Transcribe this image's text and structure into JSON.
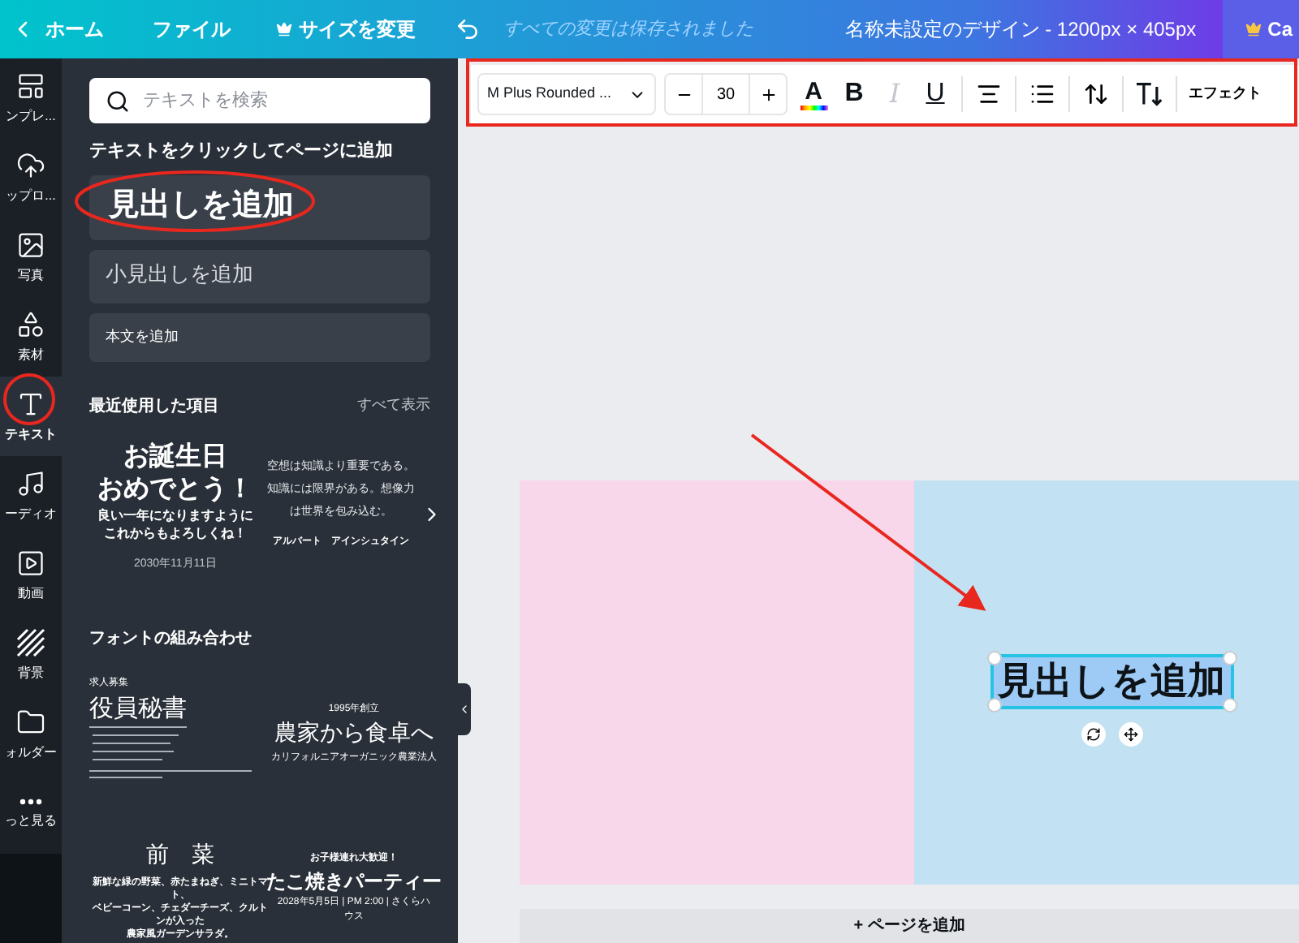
{
  "top_bar": {
    "back": "ホーム",
    "file": "ファイル",
    "resize": "サイズを変更",
    "save_status": "すべての変更は保存されました",
    "design_title": "名称未設定のデザイン - 1200px × 405px",
    "upgrade": "Ca"
  },
  "rail": [
    {
      "label": "ンプレ...",
      "kind": "layout",
      "selected": false
    },
    {
      "label": "ップロ...",
      "kind": "upload",
      "selected": false
    },
    {
      "label": "写真",
      "kind": "image",
      "selected": false
    },
    {
      "label": "素材",
      "kind": "shapes",
      "selected": false
    },
    {
      "label": "テキスト",
      "kind": "text",
      "selected": true
    },
    {
      "label": "ーディオ",
      "kind": "music",
      "selected": false
    },
    {
      "label": "動画",
      "kind": "video",
      "selected": false
    },
    {
      "label": "背景",
      "kind": "stripes",
      "selected": false
    },
    {
      "label": "ォルダー",
      "kind": "folder",
      "selected": false
    },
    {
      "label": "っと見る",
      "kind": "more",
      "selected": false
    }
  ],
  "panel": {
    "search": {
      "placeholder": "テキストを検索"
    },
    "add_heading": "テキストをクリックしてページに追加",
    "add_buttons": [
      {
        "kind": "heading",
        "label": "見出しを追加"
      },
      {
        "kind": "subheading",
        "label": "小見出しを追加"
      },
      {
        "kind": "body",
        "label": "本文を追加"
      }
    ],
    "recent": {
      "title": "最近使用した項目",
      "see_all": "すべて表示",
      "cards": [
        {
          "lines": [
            "お誕生日",
            "おめでとう！"
          ],
          "sub": [
            "良い一年になりますように",
            "これからもよろしくね！"
          ],
          "date": "2030年11月11日"
        },
        {
          "lines": [
            "空想は知識より重要である。",
            "知識には限界がある。想像力",
            "は世界を包み込む。"
          ],
          "author": "アルバート　アインシュタイン"
        }
      ]
    },
    "pairs": {
      "title": "フォントの組み合わせ",
      "cards": [
        {
          "kind": "job",
          "label": "求人募集",
          "title": "役員秘書"
        },
        {
          "kind": "farm",
          "year": "1995年創立",
          "title": "農家から食卓へ",
          "sub": "カリフォルニアオーガニック農業法人"
        },
        {
          "kind": "menu",
          "title": "前　菜",
          "lines": [
            "新鮮な緑の野菜、赤たまねぎ、ミニトマト、",
            "ベビーコーン、チェダーチーズ、クルトンが入った",
            "農家風ガーデンサラダ。"
          ]
        },
        {
          "kind": "party",
          "label": "お子様連れ大歓迎！",
          "title": "たこ焼きパーティー",
          "sub": "2028年5月5日 | PM 2:00 | さくらハウス"
        }
      ]
    }
  },
  "toolbar": {
    "font": "M Plus Rounded ...",
    "size": "30",
    "tools": [
      {
        "kind": "color",
        "label": "A"
      },
      {
        "kind": "bold",
        "label": "B",
        "disabled": false
      },
      {
        "kind": "italic",
        "label": "I",
        "disabled": true
      },
      {
        "kind": "underline",
        "label": "U",
        "disabled": false
      },
      {
        "kind": "align"
      },
      {
        "kind": "list"
      },
      {
        "kind": "spacing"
      },
      {
        "kind": "vertical"
      }
    ],
    "effects": "エフェクト"
  },
  "canvas": {
    "text": "見出しを追加",
    "selected": true,
    "add_page": "+ ページを追加"
  }
}
